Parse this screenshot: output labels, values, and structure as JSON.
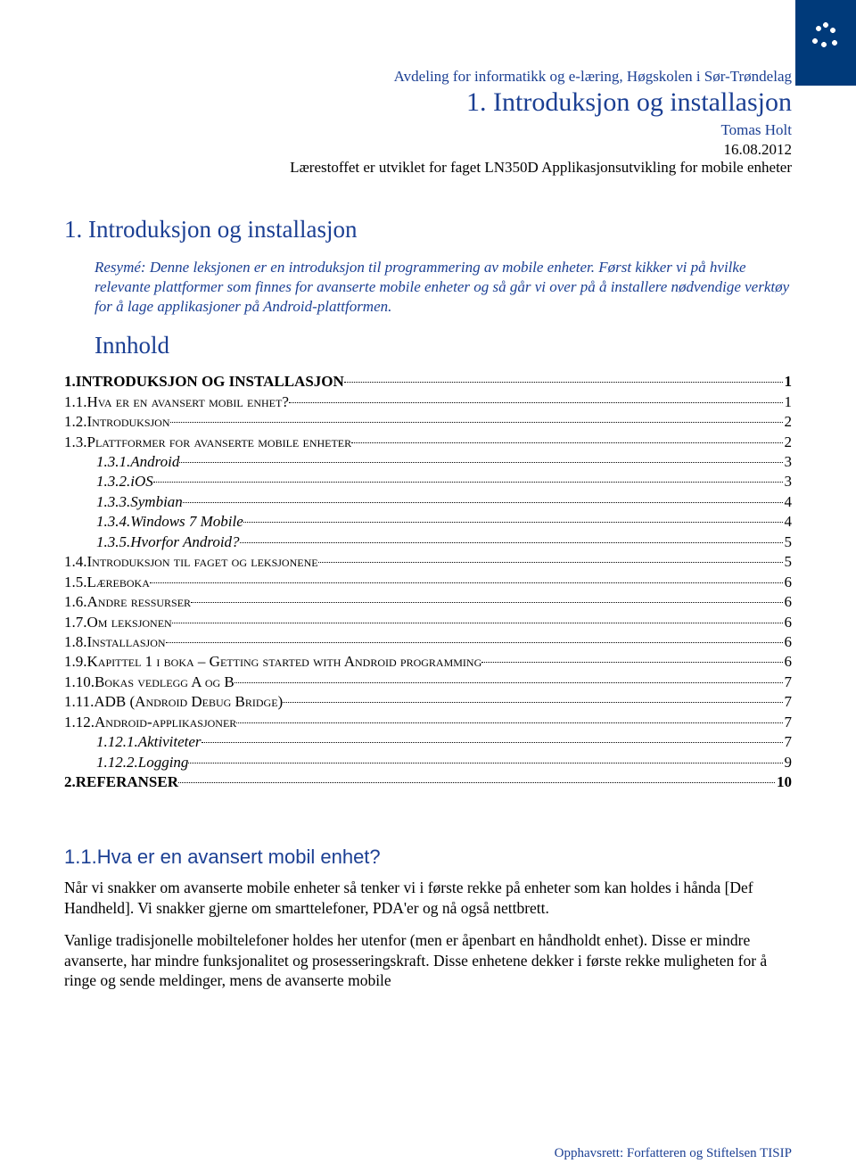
{
  "header": {
    "department": "Avdeling for informatikk og e-læring, Høgskolen i Sør-Trøndelag",
    "title": "1. Introduksjon og installasjon",
    "author": "Tomas Holt",
    "date": "16.08.2012",
    "course": "Lærestoffet er utviklet for faget LN350D Applikasjonsutvikling for mobile enheter"
  },
  "section1": {
    "title": "1. Introduksjon og installasjon",
    "resume": "Resymé: Denne leksjonen er en introduksjon til programmering av mobile enheter. Først kikker vi på hvilke relevante plattformer som finnes for avanserte mobile enheter og så går vi over på å installere nødvendige verktøy for å lage applikasjoner på Android-plattformen."
  },
  "innhold": {
    "heading": "Innhold",
    "entries": [
      {
        "level": "l1",
        "bold": true,
        "label": "1.INTRODUKSJON OG INSTALLASJON",
        "page": "1"
      },
      {
        "level": "l2",
        "bold": false,
        "label": "1.1.Hva er en avansert mobil enhet?",
        "page": "1"
      },
      {
        "level": "l2",
        "bold": false,
        "label": "1.2.Introduksjon",
        "page": "2"
      },
      {
        "level": "l2",
        "bold": false,
        "label": "1.3.Plattformer for avanserte mobile enheter",
        "page": "2"
      },
      {
        "level": "l3",
        "bold": false,
        "label": "1.3.1.Android",
        "page": "3"
      },
      {
        "level": "l3",
        "bold": false,
        "label": "1.3.2.iOS",
        "page": "3"
      },
      {
        "level": "l3",
        "bold": false,
        "label": "1.3.3.Symbian",
        "page": "4"
      },
      {
        "level": "l3",
        "bold": false,
        "label": "1.3.4.Windows 7 Mobile",
        "page": "4"
      },
      {
        "level": "l3",
        "bold": false,
        "label": "1.3.5.Hvorfor Android?",
        "page": "5"
      },
      {
        "level": "l2",
        "bold": false,
        "label": "1.4.Introduksjon til faget og leksjonene",
        "page": "5"
      },
      {
        "level": "l2",
        "bold": false,
        "label": "1.5.Læreboka",
        "page": "6"
      },
      {
        "level": "l2",
        "bold": false,
        "label": "1.6.Andre ressurser",
        "page": "6"
      },
      {
        "level": "l2",
        "bold": false,
        "label": "1.7.Om leksjonen",
        "page": "6"
      },
      {
        "level": "l2",
        "bold": false,
        "label": "1.8.Installasjon",
        "page": "6"
      },
      {
        "level": "l2",
        "bold": false,
        "label": "1.9.Kapittel 1 i boka – Getting started with Android programming",
        "page": "6"
      },
      {
        "level": "l2",
        "bold": false,
        "label": "1.10.Bokas vedlegg A og B",
        "page": "7"
      },
      {
        "level": "l2",
        "bold": false,
        "label": "1.11.ADB (Android Debug Bridge)",
        "page": "7"
      },
      {
        "level": "l2",
        "bold": false,
        "label": "1.12.Android-applikasjoner",
        "page": "7"
      },
      {
        "level": "l3",
        "bold": false,
        "label": "1.12.1.Aktiviteter",
        "page": "7"
      },
      {
        "level": "l3",
        "bold": false,
        "label": "1.12.2.Logging",
        "page": "9"
      },
      {
        "level": "l1",
        "bold": true,
        "label": "2.REFERANSER",
        "page": "10"
      }
    ]
  },
  "sub11": {
    "heading": "1.1.Hva er en avansert mobil enhet?",
    "para1": "Når vi snakker om avanserte mobile enheter så tenker vi i første rekke på enheter som kan holdes i hånda [Def Handheld]. Vi snakker gjerne om smarttelefoner, PDA'er og nå også nettbrett.",
    "para2": "Vanlige tradisjonelle mobiltelefoner holdes her utenfor (men er åpenbart en håndholdt enhet). Disse er mindre avanserte, har mindre funksjonalitet og prosesseringskraft. Disse enhetene dekker i første rekke muligheten for å ringe og sende meldinger, mens de avanserte mobile"
  },
  "footer": "Opphavsrett:  Forfatteren og Stiftelsen TISIP"
}
